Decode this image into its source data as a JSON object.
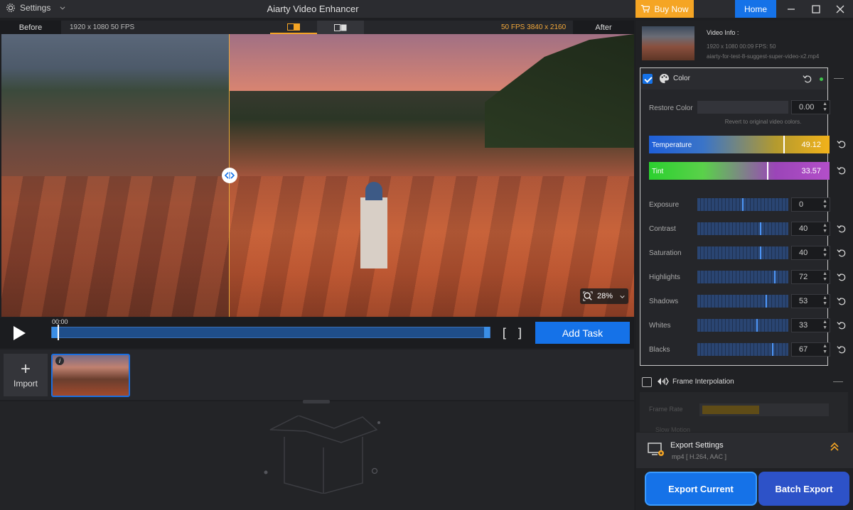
{
  "titlebar": {
    "settings_label": "Settings",
    "app_title": "Aiarty Video Enhancer",
    "buy_now_label": "Buy Now",
    "home_label": "Home"
  },
  "preview": {
    "before_label": "Before",
    "before_info": "1920 x 1080  50 FPS",
    "after_info": "50 FPS  3840 x 2160",
    "after_label": "After",
    "zoom_level": "28%"
  },
  "transport": {
    "time": "00:00",
    "add_task_label": "Add Task"
  },
  "media": {
    "import_label": "Import"
  },
  "video_info": {
    "title": "Video Info :",
    "meta": "1920 x 1080  00:09  FPS: 50",
    "file": "aiarty-for-test-8-suggest-super-video-x2.mp4"
  },
  "color": {
    "title": "Color",
    "enabled": true,
    "restore_label": "Restore Color",
    "restore_value": "0.00",
    "restore_hint": "Revert to original video colors.",
    "temperature_label": "Temperature",
    "temperature_value": "49.12",
    "temperature_level": 0.75,
    "tint_label": "Tint",
    "tint_value": "33.57",
    "tint_level": 0.66,
    "sliders": [
      {
        "label": "Exposure",
        "value": "0",
        "level": 0.5
      },
      {
        "label": "Contrast",
        "value": "40",
        "level": 0.7
      },
      {
        "label": "Saturation",
        "value": "40",
        "level": 0.7
      },
      {
        "label": "Highlights",
        "value": "72",
        "level": 0.86
      },
      {
        "label": "Shadows",
        "value": "53",
        "level": 0.76
      },
      {
        "label": "Whites",
        "value": "33",
        "level": 0.66
      },
      {
        "label": "Blacks",
        "value": "67",
        "level": 0.83
      }
    ]
  },
  "frame_interpolation": {
    "title": "Frame Interpolation",
    "enabled": false,
    "frame_rate_label": "Frame Rate",
    "slow_motion_label": "Slow Motion"
  },
  "export": {
    "settings_title": "Export Settings",
    "settings_sub": "mp4 [ H.264, AAC ]",
    "export_current_label": "Export Current",
    "batch_export_label": "Batch Export"
  },
  "colors": {
    "accent_blue": "#1572e8",
    "accent_orange": "#f5a524"
  }
}
